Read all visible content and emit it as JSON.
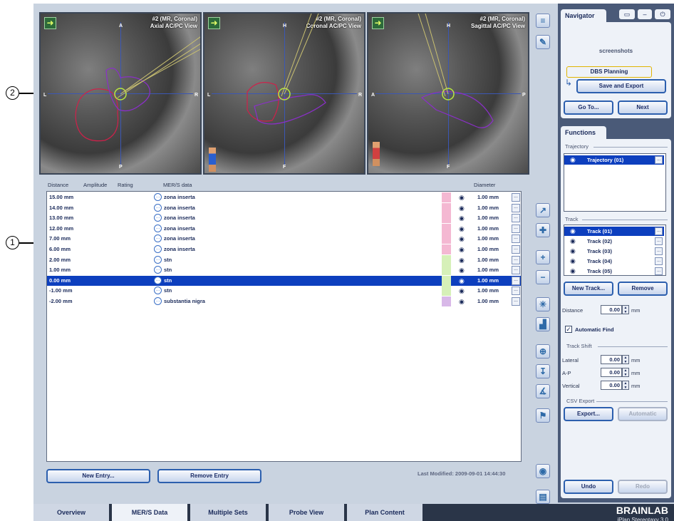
{
  "callouts": [
    "1",
    "2"
  ],
  "viewports": [
    {
      "title1": "#2 (MR, Coronal)",
      "title2": "Axial AC/PC View",
      "top": "A",
      "bottom": "P",
      "left": "L",
      "right": "R"
    },
    {
      "title1": "#2 (MR, Coronal)",
      "title2": "Coronal AC/PC View",
      "top": "H",
      "bottom": "F",
      "left": "L",
      "right": "R"
    },
    {
      "title1": "#2 (MR, Coronal)",
      "title2": "Sagittal AC/PC View",
      "top": "H",
      "bottom": "F",
      "left": "A",
      "right": "P"
    }
  ],
  "table": {
    "headers": {
      "distance": "Distance",
      "amplitude": "Amplitude",
      "rating": "Rating",
      "mer": "MER/S data",
      "diameter": "Diameter"
    },
    "rows": [
      {
        "distance": "15.00 mm",
        "mer": "zona inserta",
        "color": "#f4b8d2",
        "diameter": "1.00 mm",
        "more": "..."
      },
      {
        "distance": "14.00 mm",
        "mer": "zona inserta",
        "color": "#f4b8d2",
        "diameter": "1.00 mm",
        "more": "..."
      },
      {
        "distance": "13.00 mm",
        "mer": "zona inserta",
        "color": "#f4b8d2",
        "diameter": "1.00 mm",
        "more": "..."
      },
      {
        "distance": "12.00 mm",
        "mer": "zona inserta",
        "color": "#f4b8d2",
        "diameter": "1.00 mm",
        "more": "..."
      },
      {
        "distance": "7.00 mm",
        "mer": "zona inserta",
        "color": "#f4b8d2",
        "diameter": "1.00 mm",
        "more": "..."
      },
      {
        "distance": "6.00 mm",
        "mer": "zona inserta",
        "color": "#f4b8d2",
        "diameter": "1.00 mm",
        "more": "..."
      },
      {
        "distance": "2.00 mm",
        "mer": "stn",
        "color": "#d6f0b8",
        "diameter": "1.00 mm",
        "more": "..."
      },
      {
        "distance": "1.00 mm",
        "mer": "stn",
        "color": "#d6f0b8",
        "diameter": "1.00 mm",
        "more": "..."
      },
      {
        "distance": "0.00 mm",
        "mer": "stn",
        "color": "#d6f0b8",
        "diameter": "1.00 mm",
        "more": "...",
        "selected": true
      },
      {
        "distance": "-1.00 mm",
        "mer": "stn",
        "color": "#d6f0b8",
        "diameter": "1.00 mm",
        "more": "..."
      },
      {
        "distance": "-2.00 mm",
        "mer": "substantia nigra",
        "color": "#d8b8e8",
        "diameter": "1.00 mm",
        "more": "..."
      }
    ],
    "new_entry": "New Entry...",
    "remove_entry": "Remove Entry",
    "last_modified": "Last Modified:  2009-09-01 14:44:30"
  },
  "tabs": [
    "Overview",
    "MER/S Data",
    "Multiple Sets",
    "Probe View",
    "Plan Content"
  ],
  "active_tab": 1,
  "brand": {
    "name": "BRAINLAB",
    "product": "iPlan Stereotaxy 3.0"
  },
  "navigator": {
    "title": "Navigator",
    "screenshots": "screenshots",
    "step_current": "DBS Planning",
    "step_next": "Save and Export",
    "goto": "Go To...",
    "next": "Next"
  },
  "functions": {
    "title": "Functions",
    "trajectory_label": "Trajectory",
    "trajectory_item": "Trajectory (01)",
    "track_label": "Track",
    "tracks": [
      "Track (01)",
      "Track (02)",
      "Track (03)",
      "Track (04)",
      "Track (05)"
    ],
    "new_track": "New Track...",
    "remove": "Remove",
    "distance_label": "Distance",
    "distance_value": "0.00",
    "unit": "mm",
    "auto_find": "Automatic Find",
    "auto_find_checked": true,
    "track_shift_label": "Track Shift",
    "lateral_label": "Lateral",
    "lateral_value": "0.00",
    "ap_label": "A-P",
    "ap_value": "0.00",
    "vertical_label": "Vertical",
    "vertical_value": "0.00",
    "csv_label": "CSV Export",
    "export": "Export...",
    "automatic": "Automatic",
    "undo": "Undo",
    "redo": "Redo"
  },
  "colors": {
    "selection": "#0d3fbe",
    "accent": "#2c5fae",
    "stn": "#d6f0b8",
    "zona_inserta": "#f4b8d2",
    "substantia_nigra": "#d8b8e8"
  }
}
